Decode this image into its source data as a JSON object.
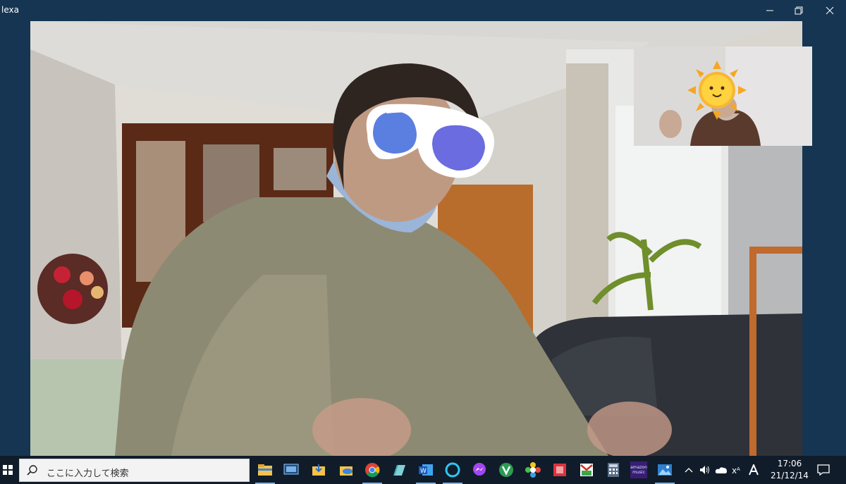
{
  "window": {
    "title": "lexa"
  },
  "search": {
    "placeholder": "ここに入力して検索"
  },
  "clock": {
    "time": "17:06",
    "date": "21/12/14"
  },
  "taskbar": {
    "apps": [
      {
        "name": "file-explorer"
      },
      {
        "name": "photos-viewer"
      },
      {
        "name": "downloads"
      },
      {
        "name": "onedrive-folder"
      },
      {
        "name": "chrome"
      },
      {
        "name": "notes"
      },
      {
        "name": "word"
      },
      {
        "name": "alexa"
      },
      {
        "name": "messenger"
      },
      {
        "name": "vivaldi"
      },
      {
        "name": "sunflower-app"
      },
      {
        "name": "red-app"
      },
      {
        "name": "gmail-photo"
      },
      {
        "name": "calculator"
      },
      {
        "name": "amazon-music"
      },
      {
        "name": "photo-gallery"
      }
    ],
    "amazon_music_label": "amazon music"
  },
  "colors": {
    "titlebar": "#163552",
    "taskbar": "#101c2a",
    "accent": "#7fb2e6"
  }
}
